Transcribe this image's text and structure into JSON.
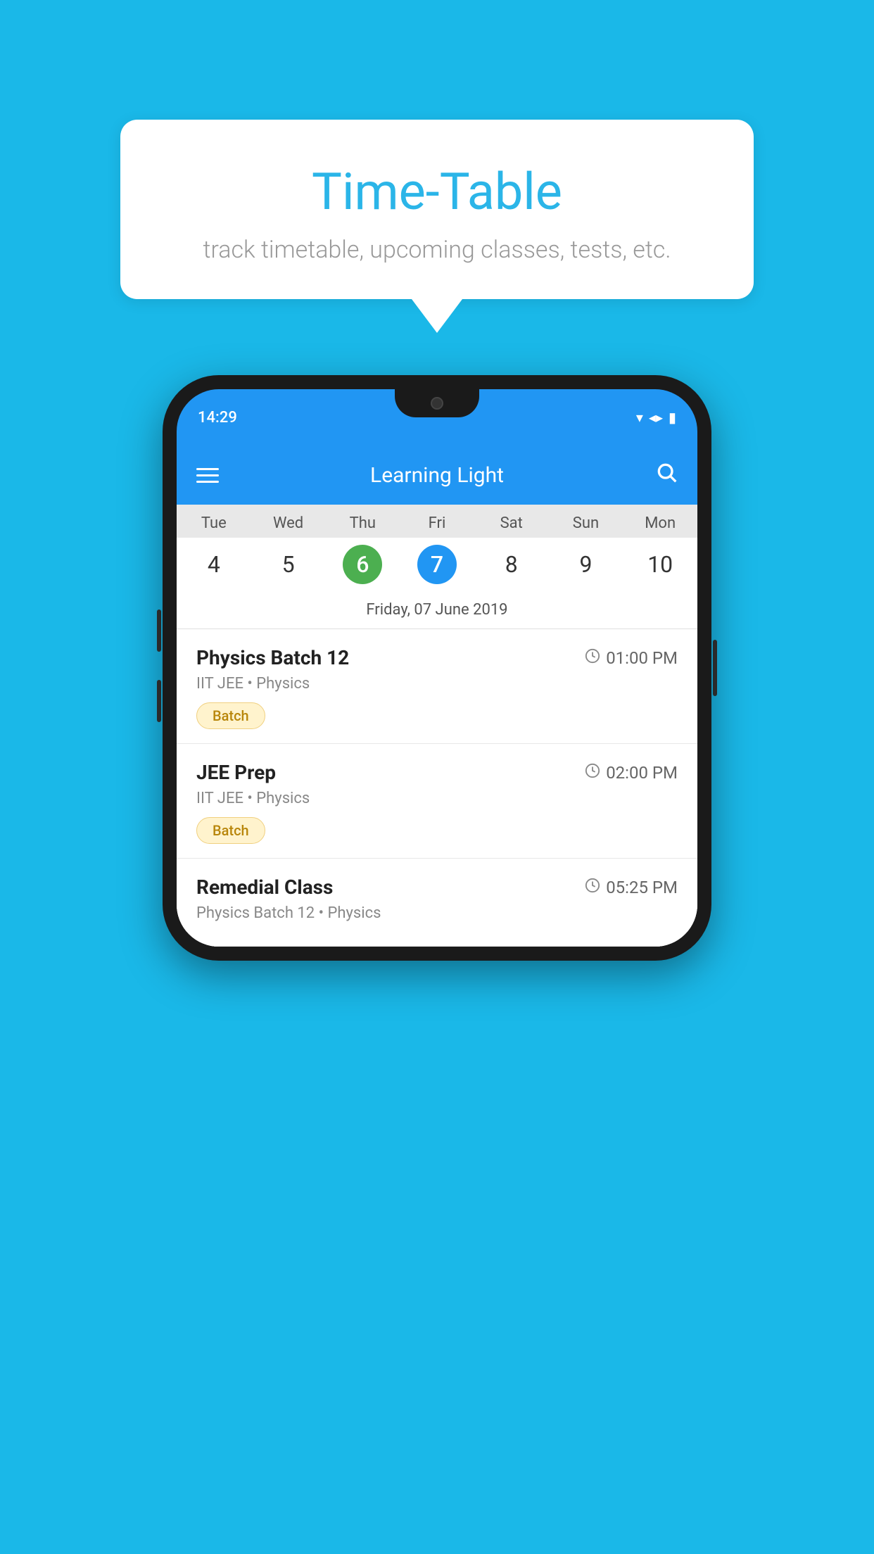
{
  "background_color": "#1ab8e8",
  "speech_bubble": {
    "title": "Time-Table",
    "subtitle": "track timetable, upcoming classes, tests, etc."
  },
  "phone": {
    "status_bar": {
      "time": "14:29"
    },
    "app_header": {
      "title": "Learning Light"
    },
    "calendar": {
      "days": [
        {
          "name": "Tue",
          "num": "4",
          "state": "normal"
        },
        {
          "name": "Wed",
          "num": "5",
          "state": "normal"
        },
        {
          "name": "Thu",
          "num": "6",
          "state": "today"
        },
        {
          "name": "Fri",
          "num": "7",
          "state": "selected"
        },
        {
          "name": "Sat",
          "num": "8",
          "state": "normal"
        },
        {
          "name": "Sun",
          "num": "9",
          "state": "normal"
        },
        {
          "name": "Mon",
          "num": "10",
          "state": "normal"
        }
      ],
      "selected_date_label": "Friday, 07 June 2019"
    },
    "schedule": [
      {
        "title": "Physics Batch 12",
        "time": "01:00 PM",
        "sub": "IIT JEE • Physics",
        "badge": "Batch"
      },
      {
        "title": "JEE Prep",
        "time": "02:00 PM",
        "sub": "IIT JEE • Physics",
        "badge": "Batch"
      },
      {
        "title": "Remedial Class",
        "time": "05:25 PM",
        "sub": "Physics Batch 12 • Physics",
        "badge": ""
      }
    ]
  }
}
